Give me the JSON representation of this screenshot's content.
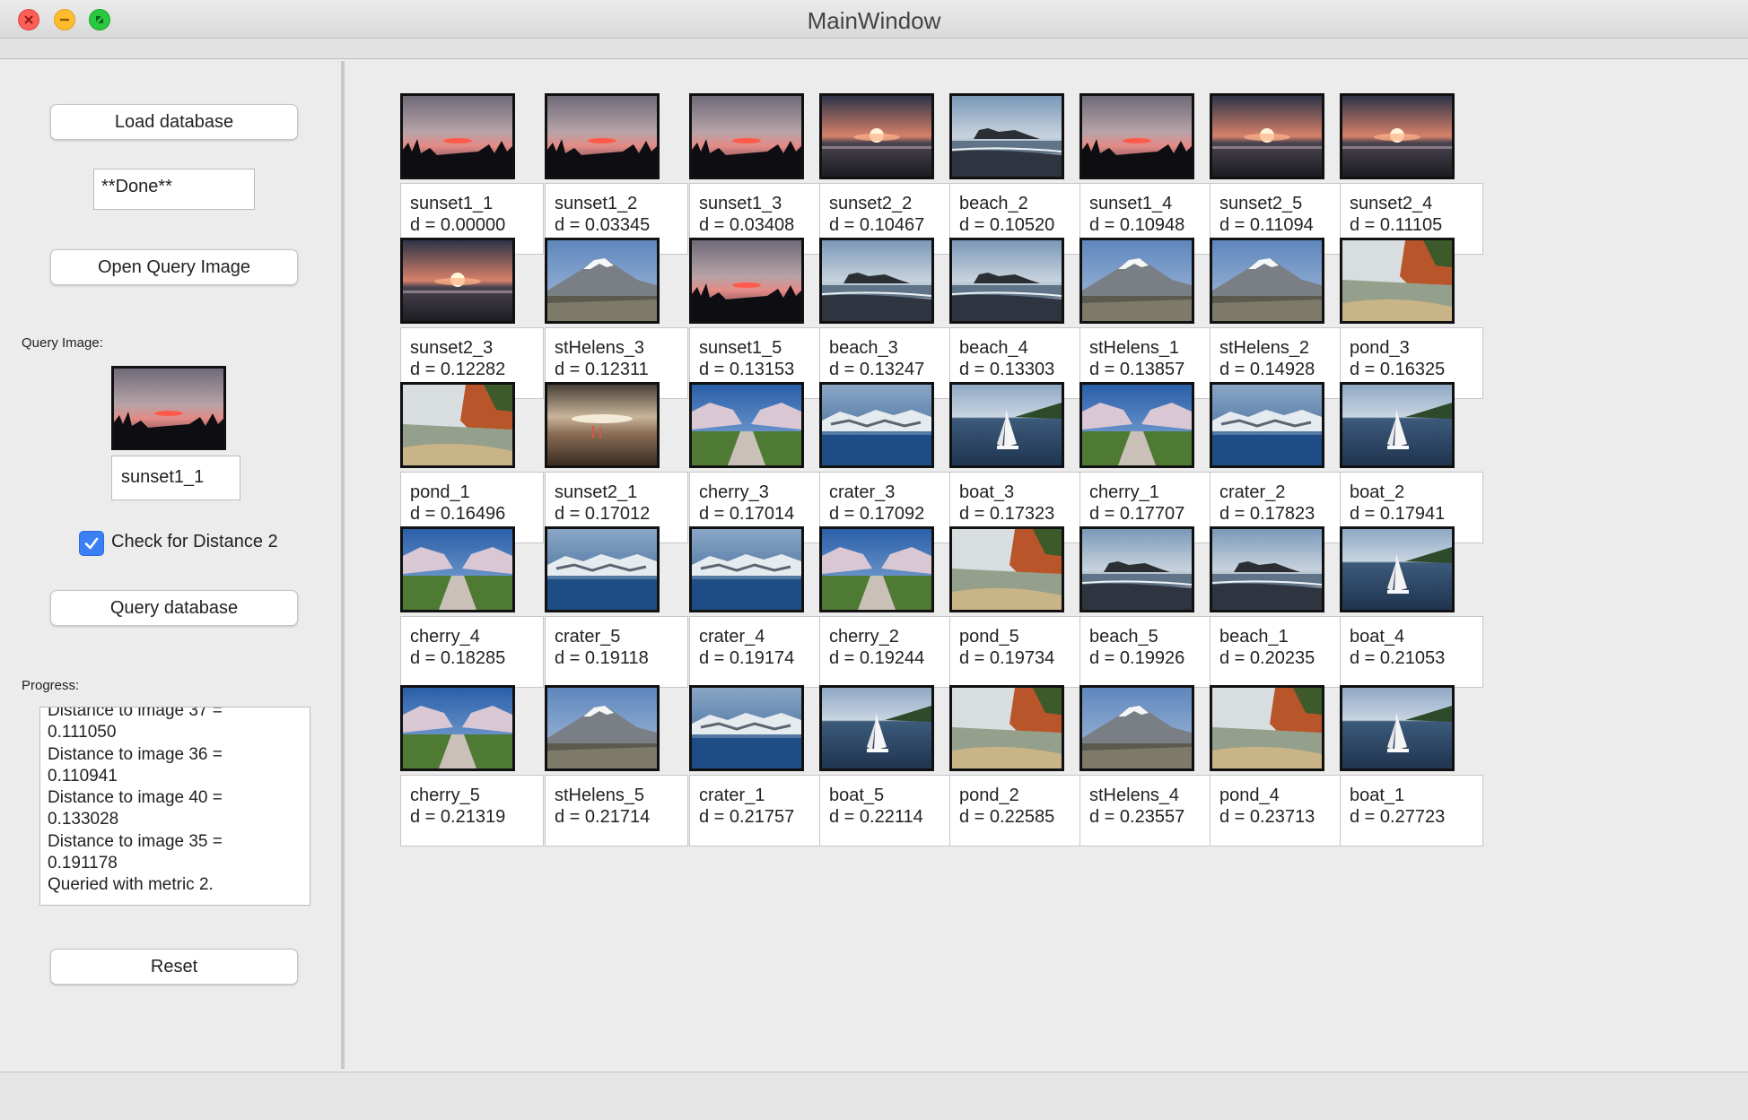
{
  "window": {
    "title": "MainWindow"
  },
  "controls": {
    "load_label": "Load database",
    "status_text": "**Done**",
    "open_query_label": "Open Query Image",
    "query_image_label": "Query Image:",
    "query_image_name": "sunset1_1",
    "check_label": "Check for Distance 2",
    "check_checked": true,
    "query_label": "Query database",
    "progress_label": "Progress:",
    "progress_lines": [
      "Distance to image 37 =",
      "0.111050",
      "Distance to image 36 =",
      "0.110941",
      "Distance to image 40 =",
      "0.133028",
      "Distance to image 35 =",
      "0.191178",
      "Queried with metric 2."
    ],
    "reset_label": "Reset"
  },
  "results": [
    {
      "name": "sunset1_1",
      "dist": "d = 0.00000",
      "kind": "sunset"
    },
    {
      "name": "sunset1_2",
      "dist": "d = 0.03345",
      "kind": "sunset"
    },
    {
      "name": "sunset1_3",
      "dist": "d = 0.03408",
      "kind": "sunset"
    },
    {
      "name": "sunset2_2",
      "dist": "d = 0.10467",
      "kind": "sunset2"
    },
    {
      "name": "beach_2",
      "dist": "d = 0.10520",
      "kind": "beach"
    },
    {
      "name": "sunset1_4",
      "dist": "d = 0.10948",
      "kind": "sunset"
    },
    {
      "name": "sunset2_5",
      "dist": "d = 0.11094",
      "kind": "sunset2"
    },
    {
      "name": "sunset2_4",
      "dist": "d = 0.11105",
      "kind": "sunset2"
    },
    {
      "name": "sunset2_3",
      "dist": "d = 0.12282",
      "kind": "sunset2"
    },
    {
      "name": "stHelens_3",
      "dist": "d = 0.12311",
      "kind": "mountain"
    },
    {
      "name": "sunset1_5",
      "dist": "d = 0.13153",
      "kind": "sunset"
    },
    {
      "name": "beach_3",
      "dist": "d = 0.13247",
      "kind": "beach"
    },
    {
      "name": "beach_4",
      "dist": "d = 0.13303",
      "kind": "beach"
    },
    {
      "name": "stHelens_1",
      "dist": "d = 0.13857",
      "kind": "mountain"
    },
    {
      "name": "stHelens_2",
      "dist": "d = 0.14928",
      "kind": "mountain"
    },
    {
      "name": "pond_3",
      "dist": "d = 0.16325",
      "kind": "pond"
    },
    {
      "name": "pond_1",
      "dist": "d = 0.16496",
      "kind": "pond"
    },
    {
      "name": "sunset2_1",
      "dist": "d = 0.17012",
      "kind": "sunset3"
    },
    {
      "name": "cherry_3",
      "dist": "d = 0.17014",
      "kind": "cherry"
    },
    {
      "name": "crater_3",
      "dist": "d = 0.17092",
      "kind": "crater"
    },
    {
      "name": "boat_3",
      "dist": "d = 0.17323",
      "kind": "boat"
    },
    {
      "name": "cherry_1",
      "dist": "d = 0.17707",
      "kind": "cherry"
    },
    {
      "name": "crater_2",
      "dist": "d = 0.17823",
      "kind": "crater"
    },
    {
      "name": "boat_2",
      "dist": "d = 0.17941",
      "kind": "boat"
    },
    {
      "name": "cherry_4",
      "dist": "d = 0.18285",
      "kind": "cherry"
    },
    {
      "name": "crater_5",
      "dist": "d = 0.19118",
      "kind": "crater"
    },
    {
      "name": "crater_4",
      "dist": "d = 0.19174",
      "kind": "crater"
    },
    {
      "name": "cherry_2",
      "dist": "d = 0.19244",
      "kind": "cherry"
    },
    {
      "name": "pond_5",
      "dist": "d = 0.19734",
      "kind": "pond"
    },
    {
      "name": "beach_5",
      "dist": "d = 0.19926",
      "kind": "beach"
    },
    {
      "name": "beach_1",
      "dist": "d = 0.20235",
      "kind": "beach"
    },
    {
      "name": "boat_4",
      "dist": "d = 0.21053",
      "kind": "boat"
    },
    {
      "name": "cherry_5",
      "dist": "d = 0.21319",
      "kind": "cherry"
    },
    {
      "name": "stHelens_5",
      "dist": "d = 0.21714",
      "kind": "mountain"
    },
    {
      "name": "crater_1",
      "dist": "d = 0.21757",
      "kind": "crater"
    },
    {
      "name": "boat_5",
      "dist": "d = 0.22114",
      "kind": "boat"
    },
    {
      "name": "pond_2",
      "dist": "d = 0.22585",
      "kind": "pond"
    },
    {
      "name": "stHelens_4",
      "dist": "d = 0.23557",
      "kind": "mountain"
    },
    {
      "name": "pond_4",
      "dist": "d = 0.23713",
      "kind": "pond"
    },
    {
      "name": "boat_1",
      "dist": "d = 0.27723",
      "kind": "boat"
    }
  ]
}
